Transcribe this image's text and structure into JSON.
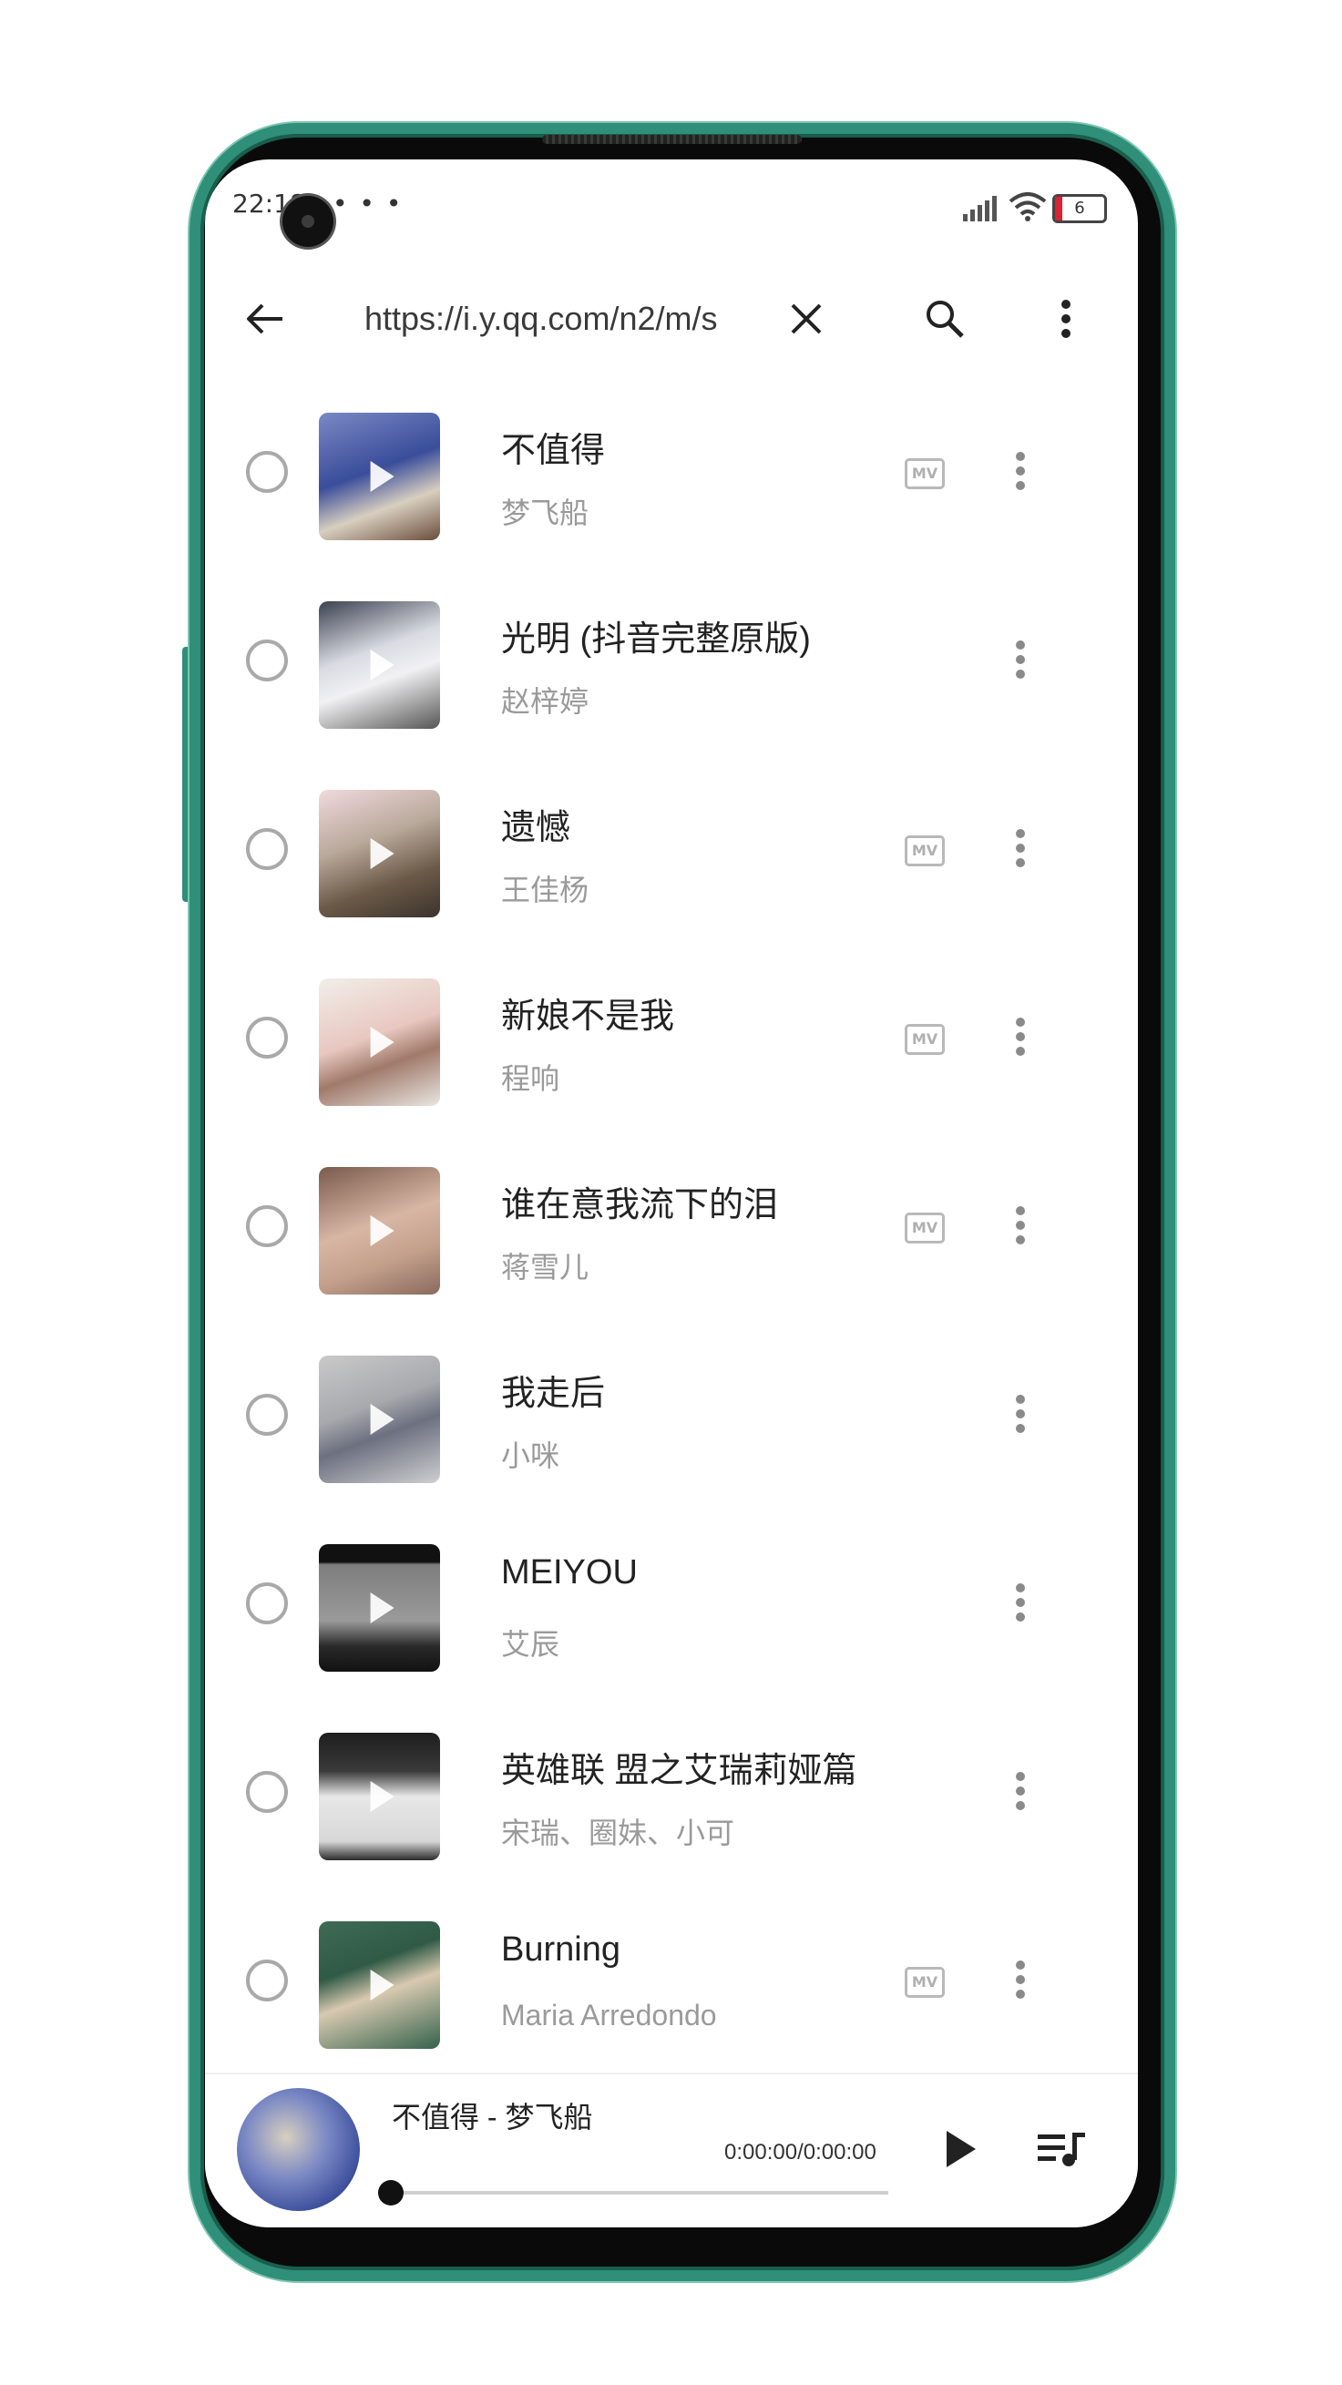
{
  "status_bar": {
    "time": "22:18",
    "dots": "• • •",
    "battery": "6"
  },
  "app_bar": {
    "url": "https://i.y.qq.com/n2/m/s"
  },
  "songs": [
    {
      "title": "不值得",
      "artist": "梦飞船",
      "mv": true
    },
    {
      "title": "光明 (抖音完整原版)",
      "artist": "赵梓婷",
      "mv": false
    },
    {
      "title": "遗憾",
      "artist": "王佳杨",
      "mv": true
    },
    {
      "title": "新娘不是我",
      "artist": "程响",
      "mv": true
    },
    {
      "title": "谁在意我流下的泪",
      "artist": "蒋雪儿",
      "mv": true
    },
    {
      "title": "我走后",
      "artist": "小咪",
      "mv": false
    },
    {
      "title": "MEIYOU",
      "artist": "艾辰",
      "mv": false
    },
    {
      "title": "英雄联 盟之艾瑞莉娅篇",
      "artist": "宋瑞、圈妹、小可",
      "mv": false
    },
    {
      "title": "Burning",
      "artist": "Maria Arredondo",
      "mv": true
    }
  ],
  "mv_label": "MV",
  "player": {
    "title": "不值得 - 梦飞船",
    "time": "0:00:00/0:00:00",
    "progress": 0
  }
}
